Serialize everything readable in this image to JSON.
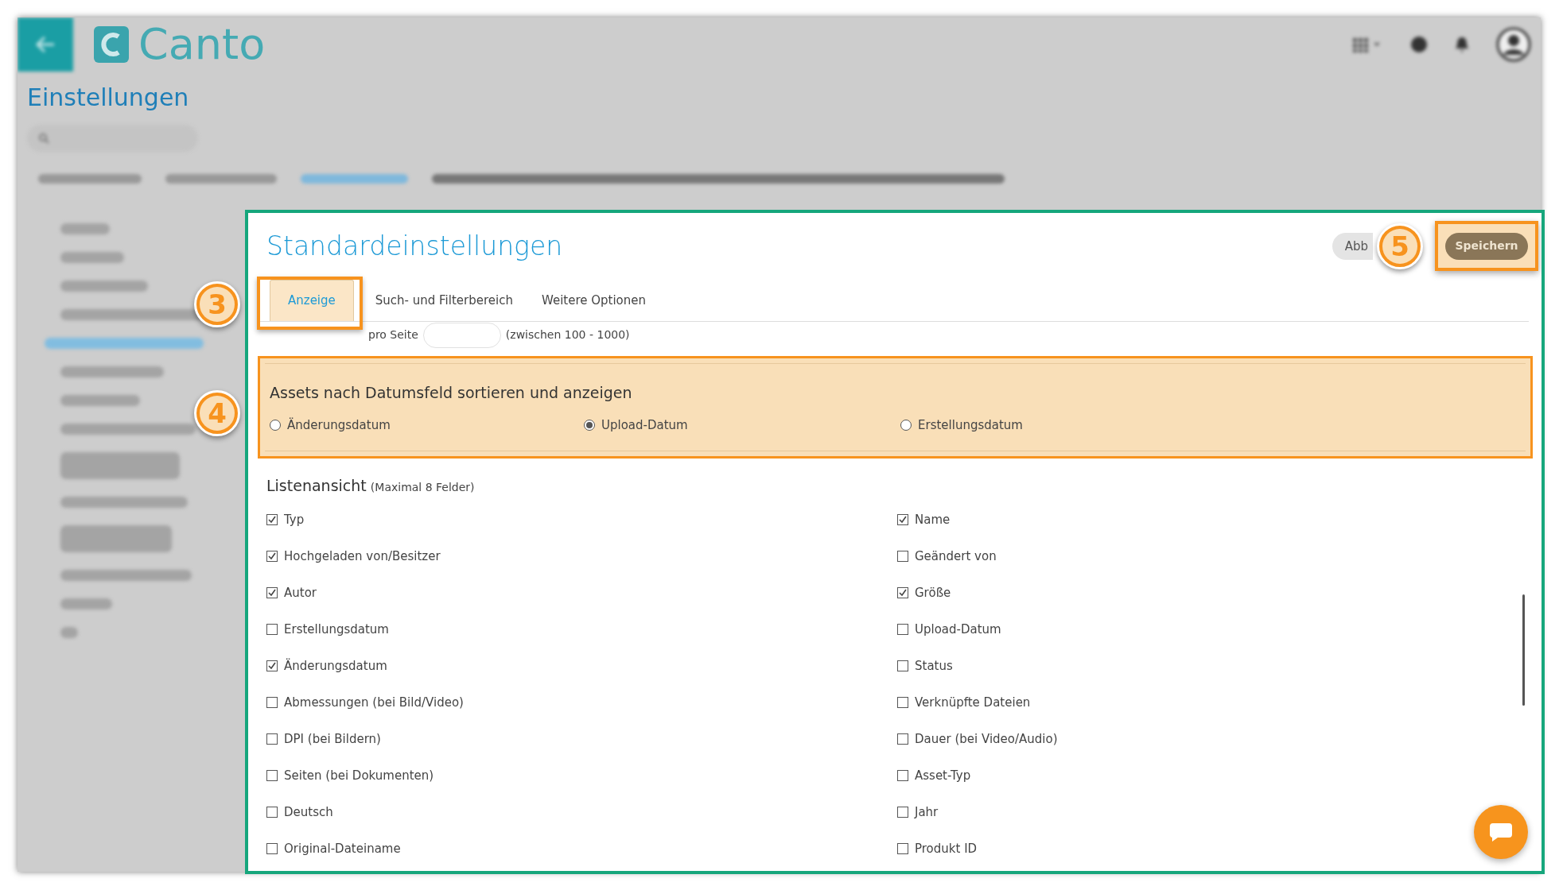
{
  "app": {
    "logo": "Canto",
    "page_title": "Einstellungen"
  },
  "panel": {
    "title": "Standardeinstellungen",
    "cancel_button": "Abb",
    "save_button": {
      "label": "Speichern",
      "disabled": true
    }
  },
  "tabs": [
    {
      "label": "Anzeige",
      "selected": true
    },
    {
      "label": "Such- und Filterbereich",
      "selected": false
    },
    {
      "label": "Weitere Optionen",
      "selected": false
    }
  ],
  "items_per_page": {
    "label": "pro Seite",
    "hint": "(zwischen 100 - 1000)"
  },
  "date_sort": {
    "title": "Assets nach Datumsfeld sortieren und anzeigen",
    "options": [
      {
        "label": "Änderungsdatum",
        "selected": false
      },
      {
        "label": "Upload-Datum",
        "selected": true
      },
      {
        "label": "Erstellungsdatum",
        "selected": false
      }
    ]
  },
  "list_view": {
    "title": "Listenansicht",
    "note": "(Maximal 8 Felder)",
    "fields": [
      {
        "label": "Typ",
        "checked": true
      },
      {
        "label": "Name",
        "checked": true
      },
      {
        "label": "Hochgeladen von/Besitzer",
        "checked": true
      },
      {
        "label": "Geändert von",
        "checked": false
      },
      {
        "label": "Autor",
        "checked": true
      },
      {
        "label": "Größe",
        "checked": true
      },
      {
        "label": "Erstellungsdatum",
        "checked": false
      },
      {
        "label": "Upload-Datum",
        "checked": false
      },
      {
        "label": "Änderungsdatum",
        "checked": true
      },
      {
        "label": "Status",
        "checked": false
      },
      {
        "label": "Abmessungen (bei Bild/Video)",
        "checked": false
      },
      {
        "label": "Verknüpfte Dateien",
        "checked": false
      },
      {
        "label": "DPI (bei Bildern)",
        "checked": false
      },
      {
        "label": "Dauer (bei Video/Audio)",
        "checked": false
      },
      {
        "label": "Seiten (bei Dokumenten)",
        "checked": false
      },
      {
        "label": "Asset-Typ",
        "checked": false
      },
      {
        "label": "Deutsch",
        "checked": false
      },
      {
        "label": "Jahr",
        "checked": false
      },
      {
        "label": "Original-Dateiname",
        "checked": false
      },
      {
        "label": "Produkt ID",
        "checked": false
      }
    ]
  },
  "annotations": [
    {
      "number": "3"
    },
    {
      "number": "4"
    },
    {
      "number": "5"
    }
  ]
}
